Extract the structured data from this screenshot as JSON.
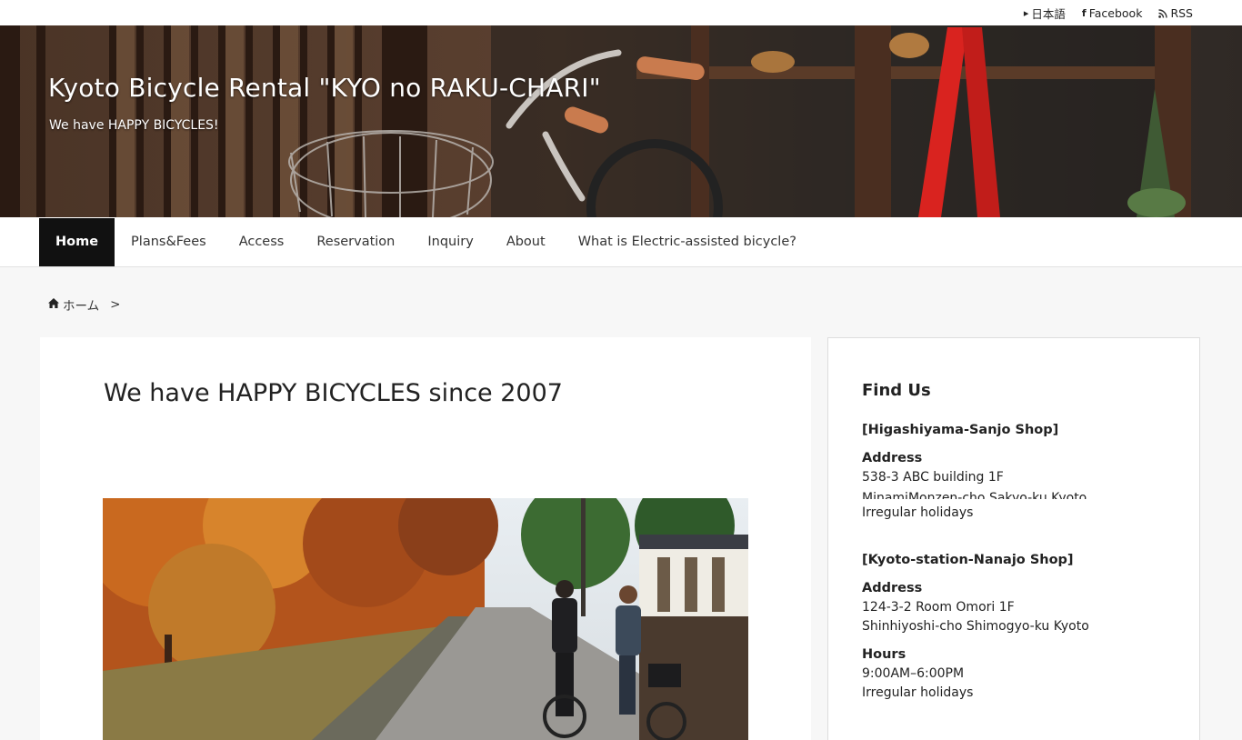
{
  "topbar": {
    "language": "日本語",
    "facebook": "Facebook",
    "rss": "RSS"
  },
  "header": {
    "title": "Kyoto Bicycle Rental \"KYO no RAKU-CHARI\"",
    "description": "We have HAPPY BICYCLES!"
  },
  "nav": {
    "items": [
      {
        "label": "Home"
      },
      {
        "label": "Plans&Fees"
      },
      {
        "label": "Access"
      },
      {
        "label": "Reservation"
      },
      {
        "label": "Inquiry"
      },
      {
        "label": "About"
      },
      {
        "label": "What is Electric-assisted bicycle?"
      }
    ]
  },
  "breadcrumb": {
    "home": "ホーム",
    "separator": ">"
  },
  "main": {
    "heading": "We have HAPPY BICYCLES since 2007"
  },
  "sidebar": {
    "title": "Find Us",
    "shop1": {
      "name": "[Higashiyama-Sanjo Shop]",
      "address_label": "Address",
      "address_line1": "538-3 ABC building 1F",
      "address_line2": "MinamiMonzen-cho Sakyo-ku Kyoto",
      "holidays": "Irregular holidays"
    },
    "shop2": {
      "name": "[Kyoto-station-Nanajo Shop]",
      "address_label": "Address",
      "address_line1": "124-3-2 Room Omori 1F",
      "address_line2": "Shinhiyoshi-cho Shimogyo-ku Kyoto",
      "hours_label": "Hours",
      "hours": "9:00AM–6:00PM",
      "holidays": "Irregular holidays"
    }
  },
  "colors": {
    "nav_active_bg": "#111111",
    "page_bg": "#f7f7f7"
  }
}
